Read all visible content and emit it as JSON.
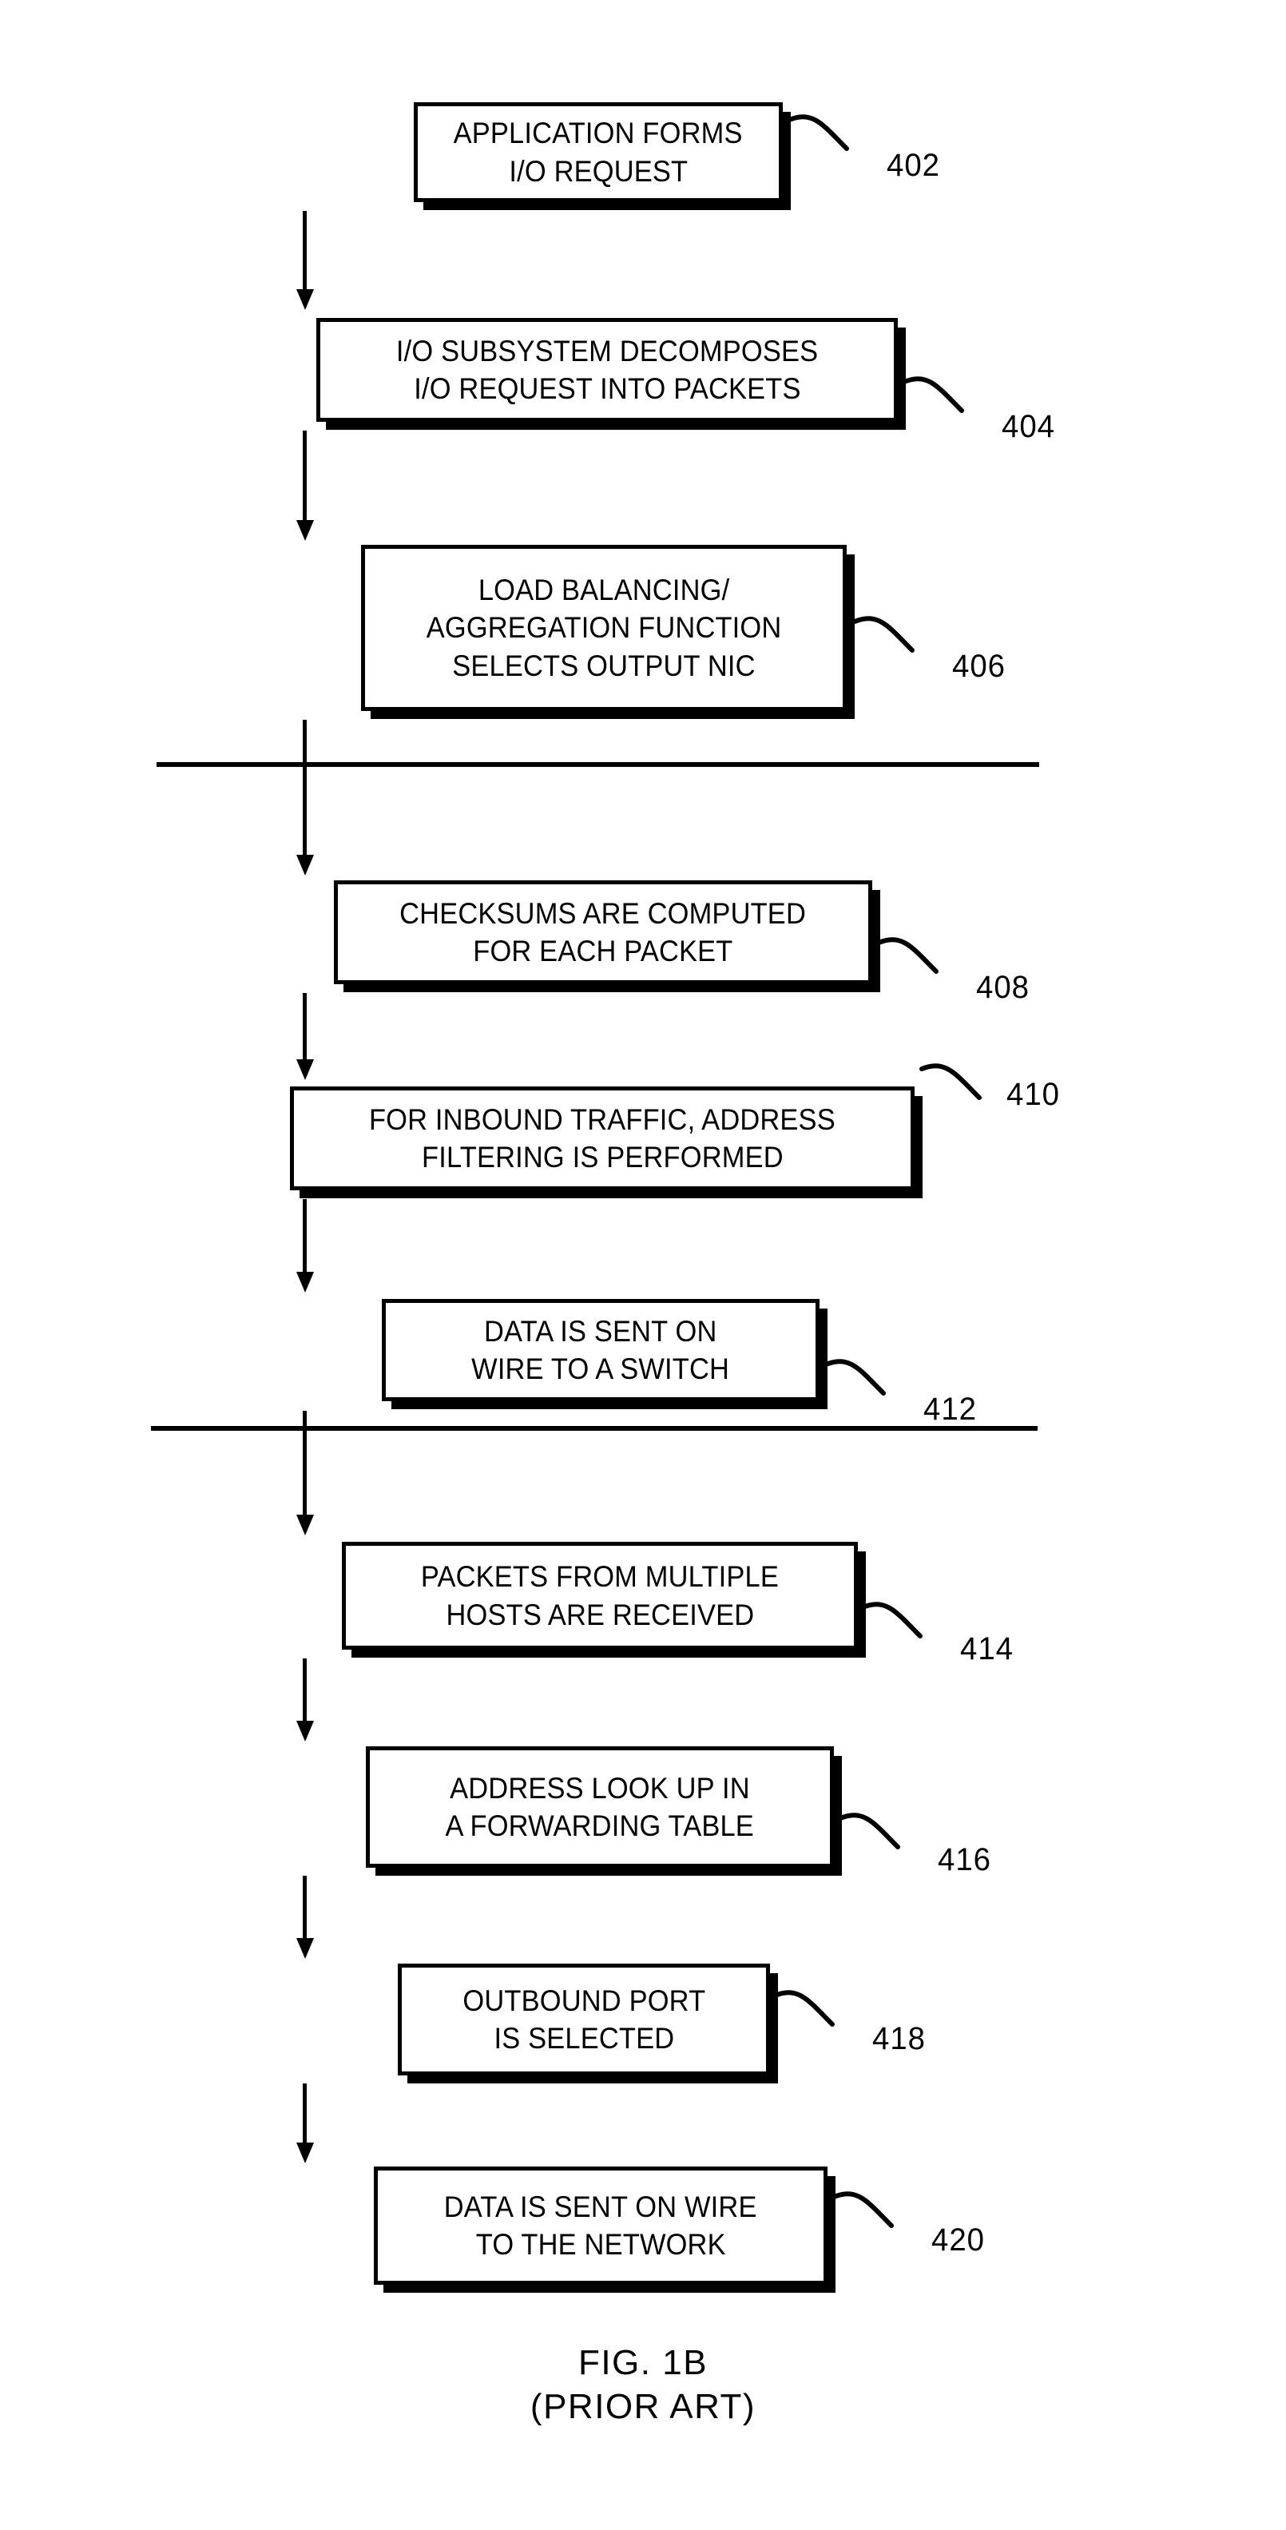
{
  "figure": {
    "caption_line1": "FIG. 1B",
    "caption_line2": "(PRIOR ART)"
  },
  "diagram": {
    "type": "flowchart",
    "orientation": "top-to-bottom",
    "section_dividers": 2,
    "nodes": [
      {
        "ref": "402",
        "lines": [
          "APPLICATION FORMS",
          "I/O REQUEST"
        ],
        "line1": "APPLICATION FORMS",
        "line2": "I/O REQUEST",
        "line3": ""
      },
      {
        "ref": "404",
        "lines": [
          "I/O SUBSYSTEM DECOMPOSES",
          "I/O REQUEST INTO PACKETS"
        ],
        "line1": "I/O SUBSYSTEM DECOMPOSES",
        "line2": "I/O REQUEST INTO PACKETS",
        "line3": ""
      },
      {
        "ref": "406",
        "lines": [
          "LOAD BALANCING/",
          "AGGREGATION FUNCTION",
          "SELECTS OUTPUT NIC"
        ],
        "line1": "LOAD BALANCING/",
        "line2": "AGGREGATION FUNCTION",
        "line3": "SELECTS OUTPUT NIC"
      },
      {
        "ref": "408",
        "lines": [
          "CHECKSUMS ARE COMPUTED",
          "FOR EACH PACKET"
        ],
        "line1": "CHECKSUMS ARE COMPUTED",
        "line2": "FOR EACH PACKET",
        "line3": ""
      },
      {
        "ref": "410",
        "lines": [
          "FOR INBOUND TRAFFIC, ADDRESS",
          "FILTERING IS PERFORMED"
        ],
        "line1": "FOR INBOUND TRAFFIC, ADDRESS",
        "line2": "FILTERING IS PERFORMED",
        "line3": ""
      },
      {
        "ref": "412",
        "lines": [
          "DATA IS SENT ON",
          "WIRE TO A SWITCH"
        ],
        "line1": "DATA IS SENT ON",
        "line2": "WIRE TO A SWITCH",
        "line3": ""
      },
      {
        "ref": "414",
        "lines": [
          "PACKETS FROM MULTIPLE",
          "HOSTS ARE RECEIVED"
        ],
        "line1": "PACKETS FROM MULTIPLE",
        "line2": "HOSTS ARE RECEIVED",
        "line3": ""
      },
      {
        "ref": "416",
        "lines": [
          "ADDRESS LOOK UP IN",
          "A FORWARDING TABLE"
        ],
        "line1": "ADDRESS LOOK UP IN",
        "line2": "A FORWARDING TABLE",
        "line3": ""
      },
      {
        "ref": "418",
        "lines": [
          "OUTBOUND PORT",
          "IS SELECTED"
        ],
        "line1": "OUTBOUND PORT",
        "line2": "IS SELECTED",
        "line3": ""
      },
      {
        "ref": "420",
        "lines": [
          "DATA IS SENT ON WIRE",
          "TO THE NETWORK"
        ],
        "line1": "DATA IS SENT ON WIRE",
        "line2": "TO THE NETWORK",
        "line3": ""
      }
    ]
  },
  "colors": {
    "ink": "#000000",
    "paper": "#ffffff"
  }
}
